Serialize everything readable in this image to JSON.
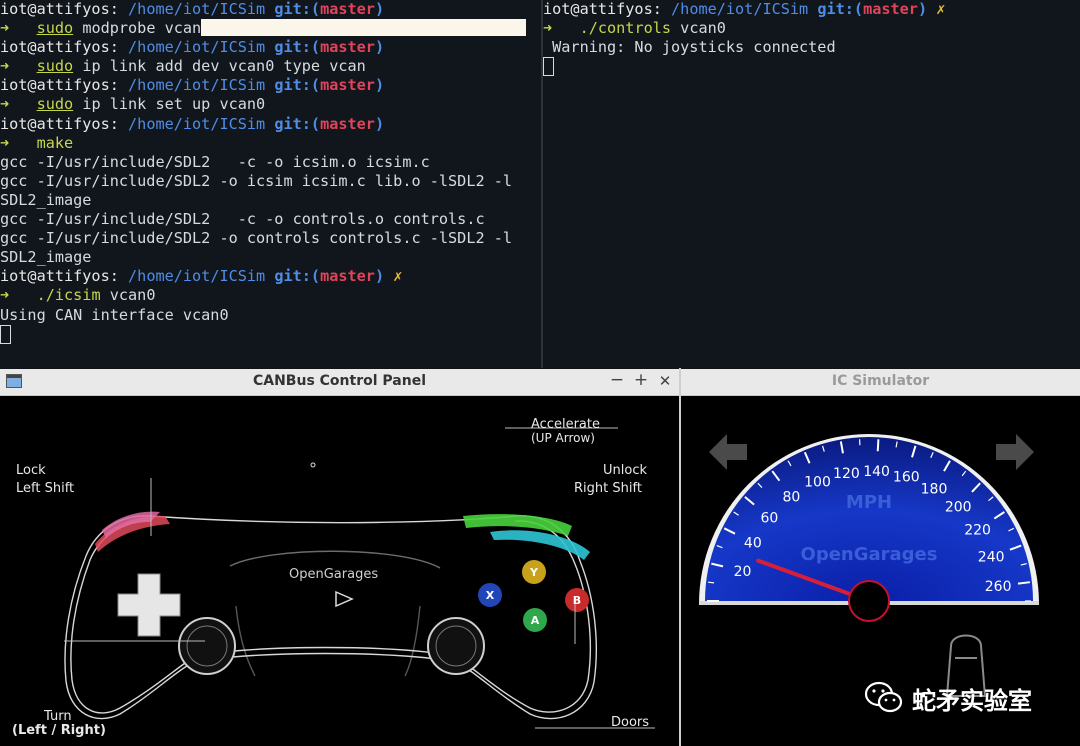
{
  "terminal_left": {
    "lines": [
      {
        "type": "prompt",
        "user": "iot@attifyos:",
        "path": "/home/iot/ICSim",
        "git": "git:(",
        "branch": "master",
        "git_close": ")",
        "dirty": ""
      },
      {
        "type": "cmd",
        "arrow": "➜",
        "cmd": "sudo",
        "rest": " modprobe vcan",
        "selection": true
      },
      {
        "type": "prompt",
        "user": "iot@attifyos:",
        "path": "/home/iot/ICSim",
        "git": "git:(",
        "branch": "master",
        "git_close": ")",
        "dirty": ""
      },
      {
        "type": "cmd",
        "arrow": "➜",
        "cmd": "sudo",
        "rest": " ip link add dev vcan0 type vcan"
      },
      {
        "type": "prompt",
        "user": "iot@attifyos:",
        "path": "/home/iot/ICSim",
        "git": "git:(",
        "branch": "master",
        "git_close": ")",
        "dirty": ""
      },
      {
        "type": "cmd",
        "arrow": "➜",
        "cmd": "sudo",
        "rest": " ip link set up vcan0"
      },
      {
        "type": "prompt",
        "user": "iot@attifyos:",
        "path": "/home/iot/ICSim",
        "git": "git:(",
        "branch": "master",
        "git_close": ")",
        "dirty": ""
      },
      {
        "type": "cmd2",
        "arrow": "➜",
        "cmd": "make",
        "rest": ""
      },
      {
        "type": "text",
        "text": "gcc -I/usr/include/SDL2   -c -o icsim.o icsim.c"
      },
      {
        "type": "text",
        "text": "gcc -I/usr/include/SDL2 -o icsim icsim.c lib.o -lSDL2 -l"
      },
      {
        "type": "text",
        "text": "SDL2_image"
      },
      {
        "type": "text",
        "text": "gcc -I/usr/include/SDL2   -c -o controls.o controls.c"
      },
      {
        "type": "text",
        "text": "gcc -I/usr/include/SDL2 -o controls controls.c -lSDL2 -l"
      },
      {
        "type": "text",
        "text": "SDL2_image"
      },
      {
        "type": "prompt",
        "user": "iot@attifyos:",
        "path": "/home/iot/ICSim",
        "git": "git:(",
        "branch": "master",
        "git_close": ")",
        "dirty": " ✗"
      },
      {
        "type": "cmd2",
        "arrow": "➜",
        "cmd": "./icsim",
        "rest": " vcan0"
      },
      {
        "type": "text",
        "text": "Using CAN interface vcan0"
      },
      {
        "type": "cursor"
      }
    ]
  },
  "terminal_right": {
    "lines": [
      {
        "type": "prompt",
        "user": "iot@attifyos:",
        "path": "/home/iot/ICSim",
        "git": "git:(",
        "branch": "master",
        "git_close": ")",
        "dirty": " ✗"
      },
      {
        "type": "cmd2",
        "arrow": "➜",
        "cmd": "./controls",
        "rest": " vcan0"
      },
      {
        "type": "text",
        "text": " Warning: No joysticks connected"
      },
      {
        "type": "cursor"
      }
    ]
  },
  "control_panel": {
    "title": "CANBus Control Panel",
    "btn_min": "−",
    "btn_max": "+",
    "btn_close": "✕",
    "accelerate": "Accelerate",
    "accelerate_key": "(UP Arrow)",
    "lock": "Lock",
    "lock_key": "Left Shift",
    "unlock": "Unlock",
    "unlock_key": "Right Shift",
    "brand": "OpenGarages",
    "turn": "Turn",
    "turn_key": "(Left / Right)",
    "doors": "Doors",
    "button_y": "Y",
    "button_x": "X",
    "button_b": "B",
    "button_a": "A"
  },
  "ic_simulator": {
    "title": "IC Simulator",
    "unit": "MPH",
    "brand": "OpenGarages",
    "speed_mph": 30,
    "gauge_max": 270,
    "tick_labels": [
      "20",
      "40",
      "60",
      "80",
      "100",
      "120",
      "140",
      "160",
      "180",
      "200",
      "220",
      "240",
      "260"
    ]
  },
  "watermark": {
    "text": "蛇矛实验室"
  },
  "colors": {
    "prompt_user": "#e7e7e7",
    "path": "#4f8de6",
    "branch": "#e0445a",
    "arrow": "#c6d64a",
    "dirty": "#e8b93a",
    "gauge_blue": "#1638c8",
    "needle": "#d81f3a"
  }
}
